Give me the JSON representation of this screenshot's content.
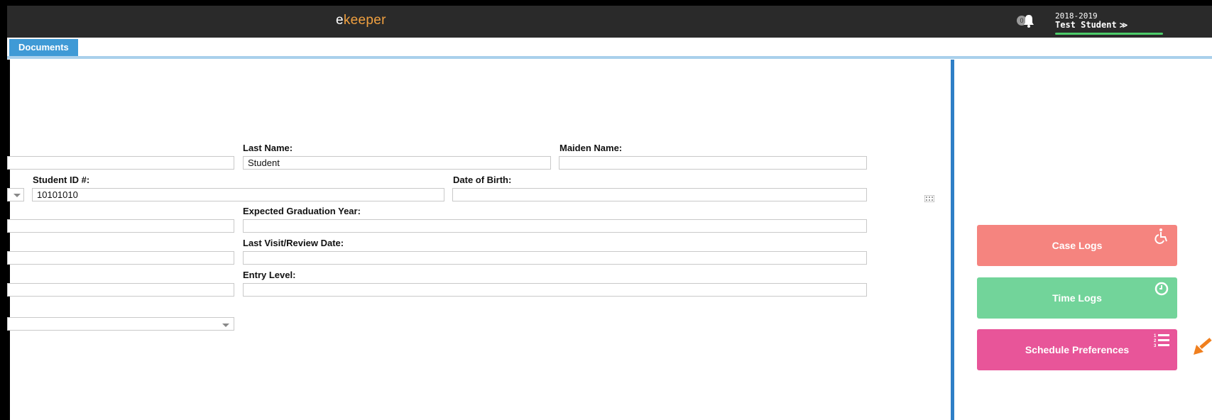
{
  "header": {
    "logo_e": "e",
    "logo_rest": "keeper",
    "notification_count": "0",
    "academic_year": "2018-2019",
    "user_name": "Test Student",
    "user_menu_chevron": "≫"
  },
  "tabs": [
    {
      "label": "Documents",
      "active": true
    }
  ],
  "form": {
    "last_name_label": "Last Name:",
    "last_name_value": "Student",
    "maiden_name_label": "Maiden Name:",
    "maiden_name_value": "",
    "student_id_label": "Student ID #:",
    "student_id_value": "10101010",
    "dob_label": "Date of Birth:",
    "dob_value": "",
    "grad_year_label": "Expected Graduation Year:",
    "grad_year_value": "",
    "last_visit_label": "Last Visit/Review Date:",
    "last_visit_value": "",
    "entry_level_label": "Entry Level:",
    "entry_level_value": ""
  },
  "sidebar": {
    "buttons": [
      {
        "label": "Case Logs",
        "icon": "wheelchair-icon",
        "color": "#f5847f"
      },
      {
        "label": "Time Logs",
        "icon": "clock-icon",
        "color": "#72d49a"
      },
      {
        "label": "Schedule Preferences",
        "icon": "ordered-list-icon",
        "color": "#e85599"
      }
    ]
  },
  "colors": {
    "topbar": "#2a2a2a",
    "tab_active": "#3f9ad6",
    "divider": "#2f7fc6",
    "logo_accent": "#f0a040",
    "annotation_arrow": "#f07f1e"
  }
}
